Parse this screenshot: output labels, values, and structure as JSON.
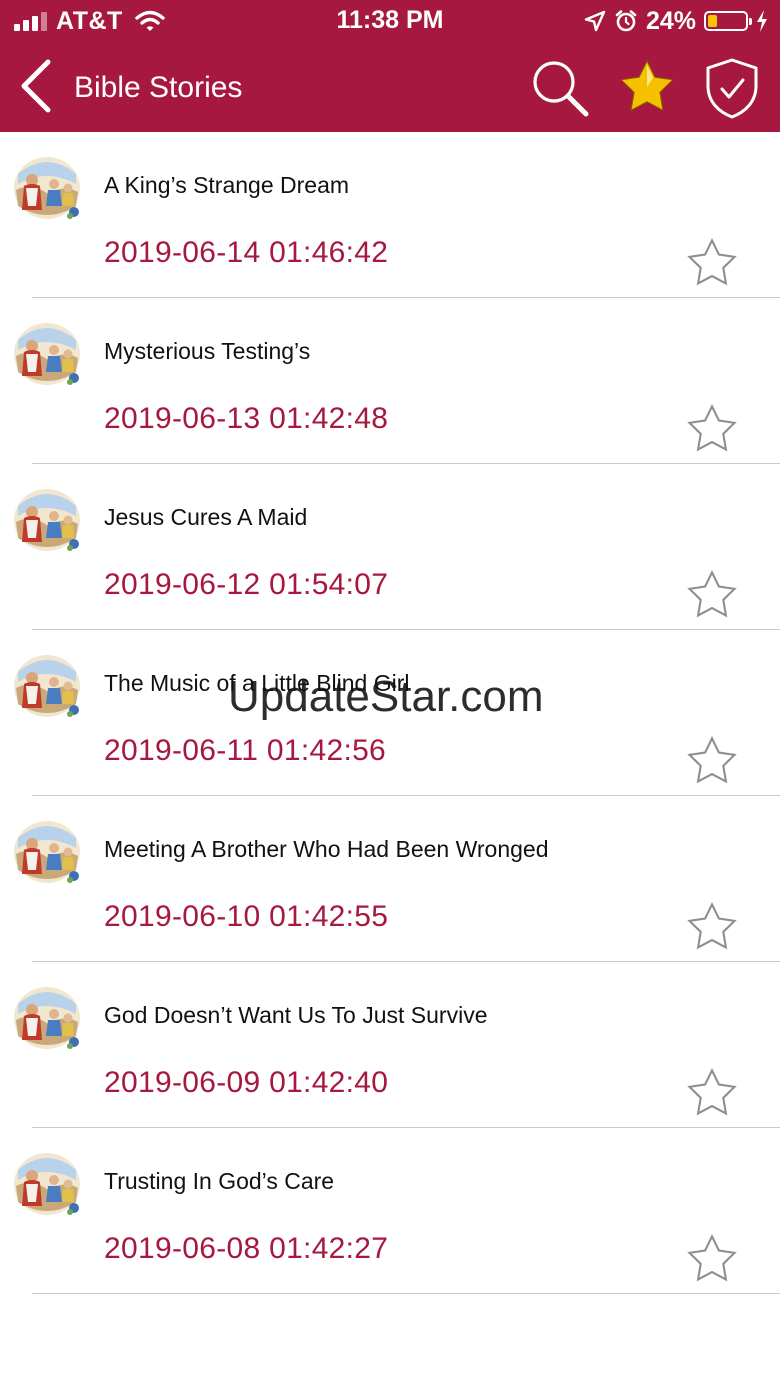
{
  "status_bar": {
    "carrier": "AT&T",
    "time": "11:38 PM",
    "battery_percent": "24%",
    "battery_level": 0.24,
    "icons": [
      "signal-icon",
      "wifi-icon",
      "location-icon",
      "alarm-icon",
      "battery-icon",
      "charging-bolt-icon"
    ]
  },
  "nav": {
    "title": "Bible Stories",
    "icons": [
      "back-chevron-icon",
      "search-icon",
      "favorite-star-icon",
      "shield-check-icon"
    ]
  },
  "colors": {
    "brand": "#a6183f",
    "date_text": "#a6183f",
    "favorite_star": "#f5c000",
    "divider": "#c9c9c9"
  },
  "stories": [
    {
      "title": "A King’s Strange Dream",
      "date": "2019-06-14 01:46:42",
      "favorited": false
    },
    {
      "title": "Mysterious Testing’s",
      "date": "2019-06-13 01:42:48",
      "favorited": false
    },
    {
      "title": "Jesus Cures A Maid",
      "date": "2019-06-12 01:54:07",
      "favorited": false
    },
    {
      "title": "The Music of a Little Blind Girl",
      "date": "2019-06-11 01:42:56",
      "favorited": false
    },
    {
      "title": "Meeting A Brother Who Had Been Wronged",
      "date": "2019-06-10 01:42:55",
      "favorited": false
    },
    {
      "title": "God Doesn’t Want Us To Just Survive",
      "date": "2019-06-09 01:42:40",
      "favorited": false
    },
    {
      "title": "Trusting In God’s Care",
      "date": "2019-06-08 01:42:27",
      "favorited": false
    }
  ],
  "watermark": "UpdateStar.com"
}
